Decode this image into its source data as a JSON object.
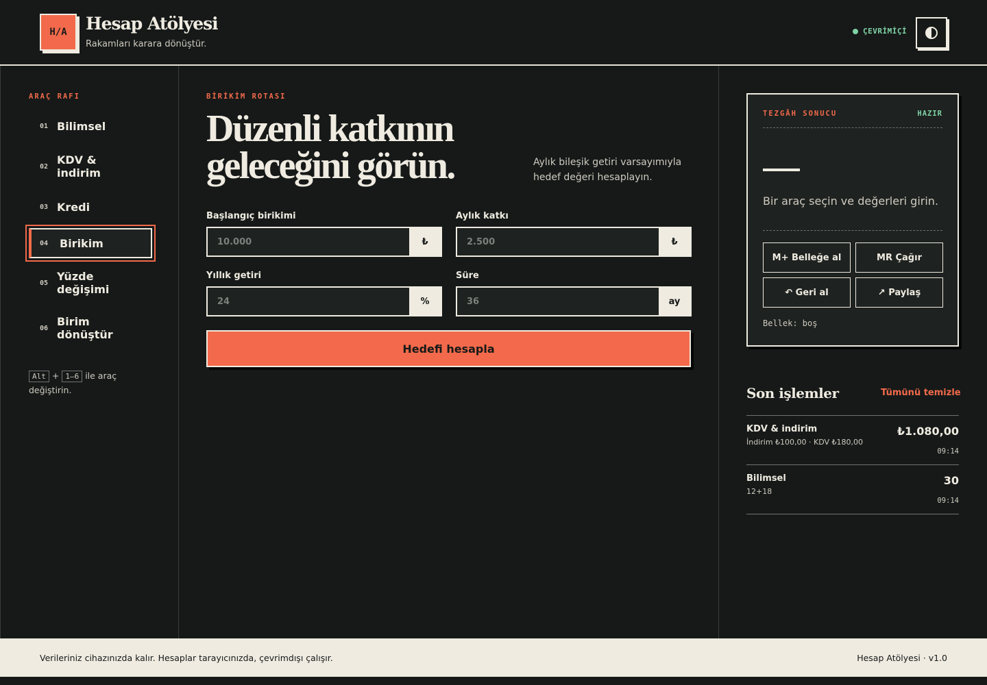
{
  "header": {
    "logo_text": "H/A",
    "title": "Hesap Atölyesi",
    "subtitle": "Rakamları karara dönüştür.",
    "status": "ÇEVRİMİÇİ",
    "theme_icon": "contrast-icon"
  },
  "sidebar": {
    "section_label": "ARAÇ RAFI",
    "items": [
      {
        "num": "01",
        "label": "Bilimsel"
      },
      {
        "num": "02",
        "label": "KDV & indirim"
      },
      {
        "num": "03",
        "label": "Kredi"
      },
      {
        "num": "04",
        "label": "Birikim"
      },
      {
        "num": "05",
        "label": "Yüzde değişimi"
      },
      {
        "num": "06",
        "label": "Birim dönüştür"
      }
    ],
    "active_index": 3,
    "shortcut": {
      "key1": "Alt",
      "plus": "+",
      "key2": "1–6",
      "text": "ile araç değiştirin."
    }
  },
  "main": {
    "eyebrow": "BİRİKİM ROTASI",
    "title": "Düzenli katkının geleceğini görün.",
    "description": "Aylık bileşik getiri varsayımıyla hedef değeri hesaplayın.",
    "fields": [
      {
        "label": "Başlangıç birikimi",
        "placeholder": "10.000",
        "unit": "₺"
      },
      {
        "label": "Aylık katkı",
        "placeholder": "2.500",
        "unit": "₺"
      },
      {
        "label": "Yıllık getiri",
        "placeholder": "24",
        "unit": "%"
      },
      {
        "label": "Süre",
        "placeholder": "36",
        "unit": "ay"
      }
    ],
    "submit_label": "Hedefi hesapla"
  },
  "result": {
    "label": "TEZGÂH SONUCU",
    "status": "HAZIR",
    "hint": "Bir araç seçin ve değerleri girin.",
    "buttons": {
      "memory_add": "M+ Belleğe al",
      "memory_recall": "MR Çağır",
      "undo": "↶ Geri al",
      "share": "↗ Paylaş"
    },
    "memory": "Bellek: boş"
  },
  "history": {
    "title": "Son işlemler",
    "clear_label": "Tümünü temizle",
    "items": [
      {
        "name": "KDV & indirim",
        "detail": "İndirim ₺100,00 · KDV ₺180,00",
        "value": "₺1.080,00",
        "time": "09:14"
      },
      {
        "name": "Bilimsel",
        "detail": "12+18",
        "value": "30",
        "time": "09:14"
      }
    ]
  },
  "footer": {
    "left": "Verileriniz cihazınızda kalır. Hesaplar tarayıcınızda, çevrimdışı çalışır.",
    "right": "Hesap Atölyesi · v1.0"
  },
  "colors": {
    "background": "#161918",
    "accent": "#f26a4b",
    "status": "#7fd3a6",
    "paper": "#efebe1"
  }
}
